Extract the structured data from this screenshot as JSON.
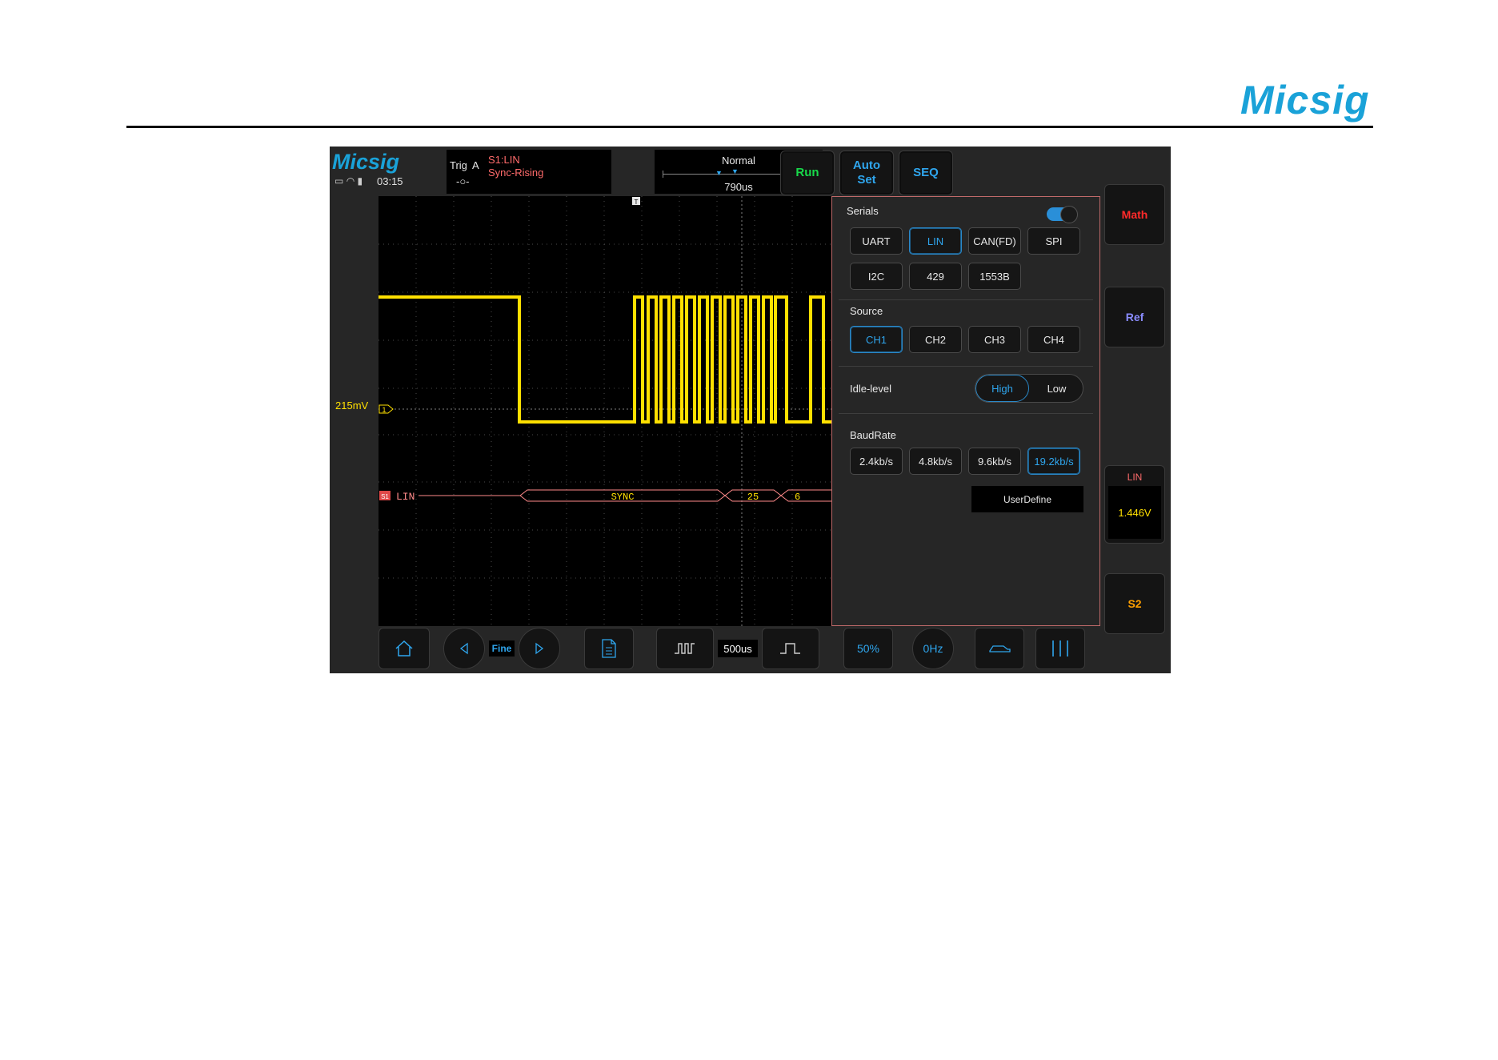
{
  "page": {
    "brand": "Micsig"
  },
  "device": {
    "brand": "Micsig",
    "time": "03:15",
    "trigger": {
      "label": "Trig",
      "source": "A",
      "title": "S1:LIN",
      "mode": "Sync-Rising"
    },
    "timebase_header": {
      "mode": "Normal",
      "delay": "790us"
    },
    "buttons": {
      "run": "Run",
      "autoset_line1": "Auto",
      "autoset_line2": "Set",
      "seq": "SEQ"
    },
    "side": {
      "math": "Math",
      "ref": "Ref",
      "lin_title": "LIN",
      "lin_value": "1.446V",
      "s2": "S2"
    },
    "colors": {
      "accent": "#2fa6ee",
      "ch1": "#ffe000",
      "decode": "#ff6b6b",
      "run": "#18d84a",
      "math": "#ff2a2a",
      "ref": "#8a8cff",
      "s2": "#ffa000"
    }
  },
  "scope": {
    "ch1_offset_label": "215mV",
    "ch1_marker": "1",
    "decode_marker": "S1",
    "decode_label": "LIN",
    "packets": [
      "SYNC",
      "25",
      "6"
    ]
  },
  "menu": {
    "serials_title": "Serials",
    "serials_enabled": true,
    "protocols": [
      "UART",
      "LIN",
      "CAN(FD)",
      "SPI",
      "I2C",
      "429",
      "1553B"
    ],
    "selected_protocol": "LIN",
    "source_title": "Source",
    "sources": [
      "CH1",
      "CH2",
      "CH3",
      "CH4"
    ],
    "selected_source": "CH1",
    "idle_title": "Idle-level",
    "idle_options": [
      "High",
      "Low"
    ],
    "selected_idle": "High",
    "baud_title": "BaudRate",
    "baud_rates": [
      "2.4kb/s",
      "4.8kb/s",
      "9.6kb/s",
      "19.2kb/s"
    ],
    "selected_baud": "19.2kb/s",
    "user_define": "UserDefine"
  },
  "toolbar": {
    "fine": "Fine",
    "timebase": "500us",
    "fifty_percent": "50%",
    "zero_hz": "0Hz",
    "icons": [
      "home-icon",
      "left-arrow-icon",
      "right-arrow-icon",
      "save-file-icon",
      "zoom-out-wave-icon",
      "zoom-in-wave-icon",
      "car-icon",
      "cursor-lines-icon"
    ]
  }
}
